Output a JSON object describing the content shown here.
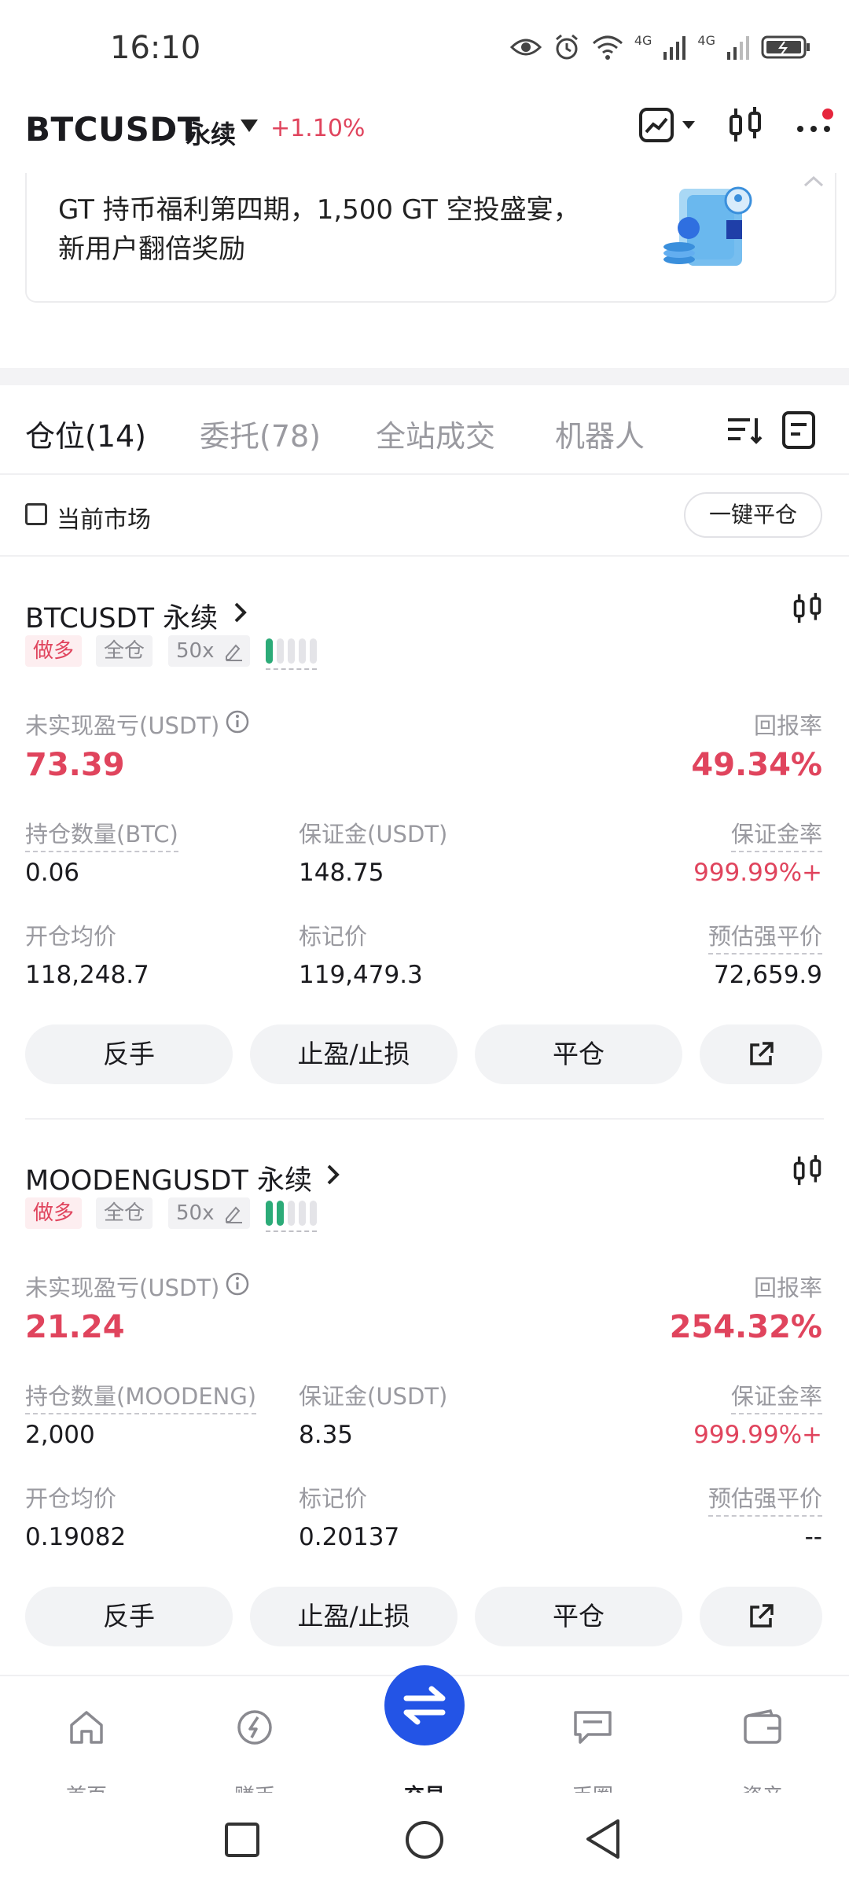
{
  "status_bar": {
    "time": "16:10",
    "net1": "4G",
    "net2": "4G"
  },
  "header": {
    "symbol": "BTCUSDT",
    "type": "永续",
    "change": "+1.10%"
  },
  "banner": {
    "line1": "GT 持币福利第四期，1,500 GT 空投盛宴，",
    "line2": "新用户翻倍奖励"
  },
  "tabs": [
    {
      "label": "仓位(14)",
      "active": true
    },
    {
      "label": "委托(78)",
      "active": false
    },
    {
      "label": "全站成交",
      "active": false
    },
    {
      "label": "机器人",
      "active": false
    }
  ],
  "filter": {
    "current_market": "当前市场",
    "close_all": "一键平仓"
  },
  "positions": [
    {
      "title": "BTCUSDT 永续",
      "side": "做多",
      "margin_mode": "全仓",
      "leverage": "50x",
      "adl_level": 1,
      "pnl_label": "未实现盈亏(USDT)",
      "pnl": "73.39",
      "roe_label": "回报率",
      "roe": "49.34%",
      "size_label": "持仓数量(BTC)",
      "size": "0.06",
      "margin_label": "保证金(USDT)",
      "margin": "148.75",
      "margin_ratio_label": "保证金率",
      "margin_ratio": "999.99%+",
      "entry_label": "开仓均价",
      "entry": "118,248.7",
      "mark_label": "标记价",
      "mark": "119,479.3",
      "liq_label": "预估强平价",
      "liq": "72,659.9",
      "btn_reverse": "反手",
      "btn_tpsl": "止盈/止损",
      "btn_close": "平仓"
    },
    {
      "title": "MOODENGUSDT 永续",
      "side": "做多",
      "margin_mode": "全仓",
      "leverage": "50x",
      "adl_level": 2,
      "pnl_label": "未实现盈亏(USDT)",
      "pnl": "21.24",
      "roe_label": "回报率",
      "roe": "254.32%",
      "size_label": "持仓数量(MOODENG)",
      "size": "2,000",
      "margin_label": "保证金(USDT)",
      "margin": "8.35",
      "margin_ratio_label": "保证金率",
      "margin_ratio": "999.99%+",
      "entry_label": "开仓均价",
      "entry": "0.19082",
      "mark_label": "标记价",
      "mark": "0.20137",
      "liq_label": "预估强平价",
      "liq": "--",
      "btn_reverse": "反手",
      "btn_tpsl": "止盈/止损",
      "btn_close": "平仓"
    }
  ],
  "bottom_nav": [
    {
      "label": "首页",
      "icon": "home-icon"
    },
    {
      "label": "赚币",
      "icon": "earn-icon"
    },
    {
      "label": "交易",
      "icon": "trade-icon",
      "active": true
    },
    {
      "label": "币圈",
      "icon": "chat-icon"
    },
    {
      "label": "资产",
      "icon": "wallet-icon"
    }
  ],
  "colors": {
    "red": "#e0445d",
    "green": "#2cab78",
    "blue": "#2354e6"
  }
}
